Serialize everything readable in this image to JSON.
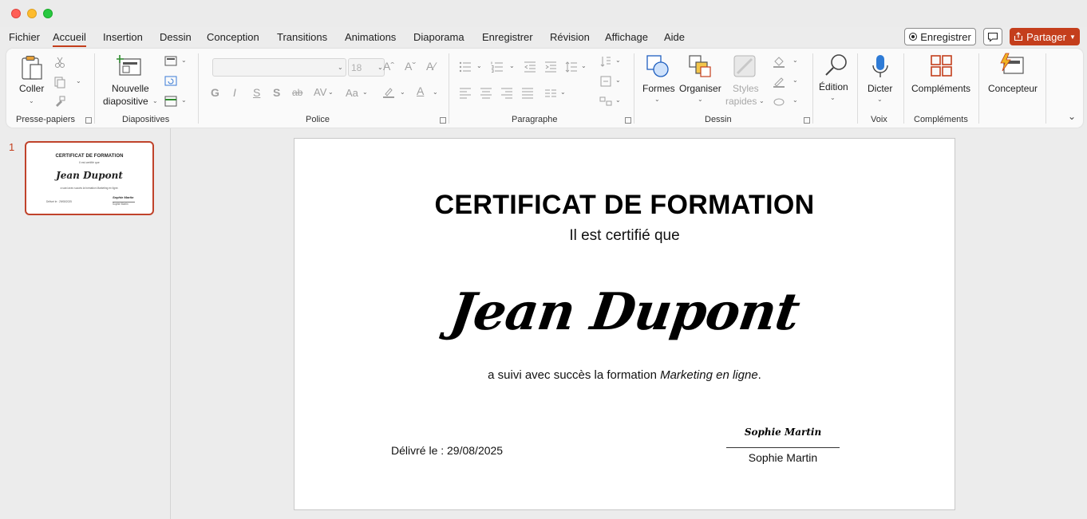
{
  "menu": {
    "tabs": [
      {
        "label": "Fichier"
      },
      {
        "label": "Accueil"
      },
      {
        "label": "Insertion"
      },
      {
        "label": "Dessin"
      },
      {
        "label": "Conception"
      },
      {
        "label": "Transitions"
      },
      {
        "label": "Animations"
      },
      {
        "label": "Diaporama"
      },
      {
        "label": "Enregistrer"
      },
      {
        "label": "Révision"
      },
      {
        "label": "Affichage"
      },
      {
        "label": "Aide"
      }
    ],
    "active_tab": "Accueil",
    "record_label": "Enregistrer",
    "share_label": "Partager"
  },
  "ribbon": {
    "clipboard": {
      "paste_label": "Coller",
      "group_label": "Presse-papiers"
    },
    "slides": {
      "new_slide_line1": "Nouvelle",
      "new_slide_line2": "diapositive",
      "group_label": "Diapositives"
    },
    "font": {
      "font_size": "18",
      "group_label": "Police",
      "bold": "G",
      "italic": "I",
      "underline": "S",
      "shadow": "S",
      "strike": "ab",
      "spacing": "AV",
      "case": "Aa",
      "color": "A"
    },
    "paragraph": {
      "group_label": "Paragraphe"
    },
    "drawing": {
      "shapes_label": "Formes",
      "arrange_label": "Organiser",
      "quick_styles_line1": "Styles",
      "quick_styles_line2": "rapides",
      "group_label": "Dessin"
    },
    "editing": {
      "label": "Édition"
    },
    "voice": {
      "dictate_label": "Dicter",
      "group_label": "Voix"
    },
    "addins": {
      "label": "Compléments",
      "group_label": "Compléments"
    },
    "designer": {
      "label": "Concepteur"
    }
  },
  "slides_panel": {
    "slide_number": "1",
    "thumb_title": "CERTIFICAT DE FORMATION",
    "thumb_sub": "Il est certifié que",
    "thumb_name": "Jean Dupont",
    "thumb_desc": "a suivi avec succès la formation Marketing en ligne.",
    "thumb_date": "Délivré le : 29/08/2025",
    "thumb_sig": "Sophie Martin",
    "thumb_signame": "Sophie Martin"
  },
  "slide": {
    "title": "CERTIFICAT DE FORMATION",
    "subtitle": "Il est certifié que",
    "recipient": "Jean Dupont",
    "desc_prefix": "a suivi avec succès la formation ",
    "course": "Marketing en ligne",
    "desc_suffix": ".",
    "date": "Délivré le : 29/08/2025",
    "signature_script": "Sophie Martin",
    "signatory": "Sophie Martin"
  },
  "colors": {
    "accent": "#c43e1c"
  }
}
